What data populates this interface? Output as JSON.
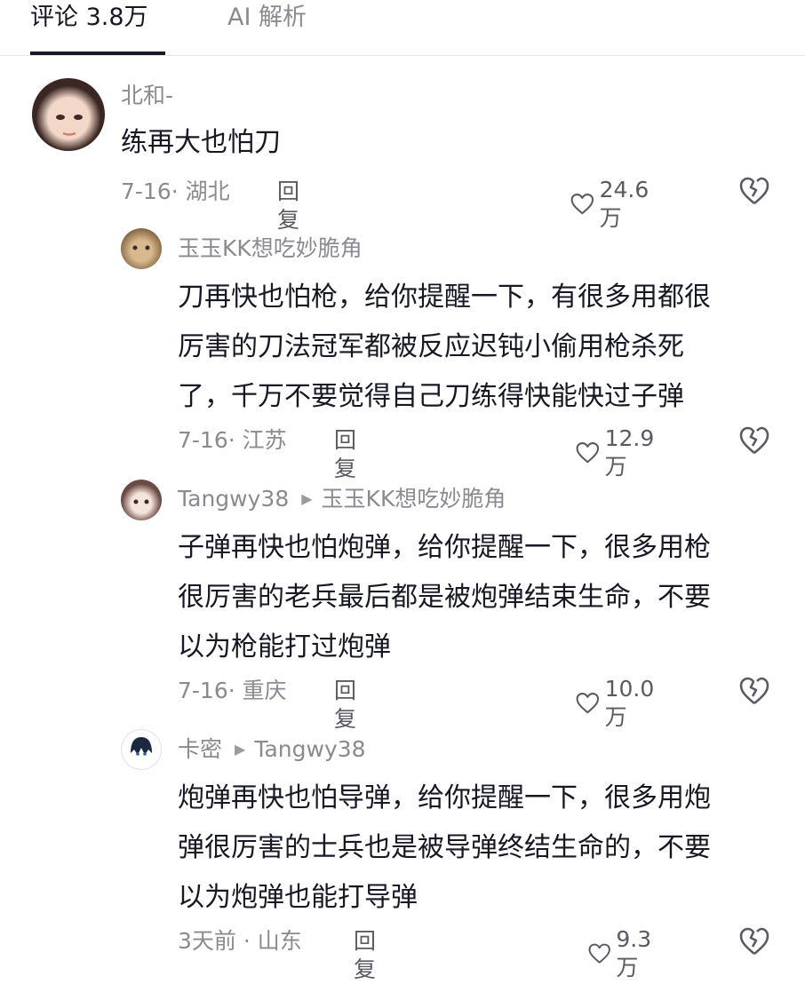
{
  "tabs": [
    {
      "label": "评论 3.8万"
    },
    {
      "label": "AI 解析"
    }
  ],
  "comments": [
    {
      "username": "北和-",
      "lines": [
        "练再大也怕刀"
      ],
      "meta": "7-16· 湖北",
      "reply_label": "回复",
      "likes": "24.6万"
    },
    {
      "username": "玉玉KK想吃妙脆角",
      "lines": [
        "刀再快也怕枪，给你提醒一下，有很多用都很",
        "厉害的刀法冠军都被反应迟钝小偷用枪杀死",
        "了，千万不要觉得自己刀练得快能快过子弹"
      ],
      "meta": "7-16· 江苏",
      "reply_label": "回复",
      "likes": "12.9万"
    },
    {
      "username": "Tangwy38",
      "reply_to": "玉玉KK想吃妙脆角",
      "lines": [
        "子弹再快也怕炮弹，给你提醒一下，很多用枪",
        "很厉害的老兵最后都是被炮弹结束生命，不要",
        "以为枪能打过炮弹"
      ],
      "meta": "7-16· 重庆",
      "reply_label": "回复",
      "likes": "10.0万"
    },
    {
      "username": "卡密",
      "reply_to": "Tangwy38",
      "lines": [
        "炮弹再快也怕导弹，给你提醒一下，很多用炮",
        "弹很厉害的士兵也是被导弹终结生命的，不要",
        "以为炮弹也能打导弹"
      ],
      "meta": "3天前 · 山东",
      "reply_label": "回复",
      "likes": "9.3万"
    }
  ],
  "icons": {
    "like": "heart-outline-icon",
    "dislike": "broken-heart-icon",
    "reply_arrow": "right-triangle-icon"
  },
  "colors": {
    "text_primary": "#161823",
    "text_secondary": "#8a8b91",
    "divider": "#e6e6e6"
  }
}
